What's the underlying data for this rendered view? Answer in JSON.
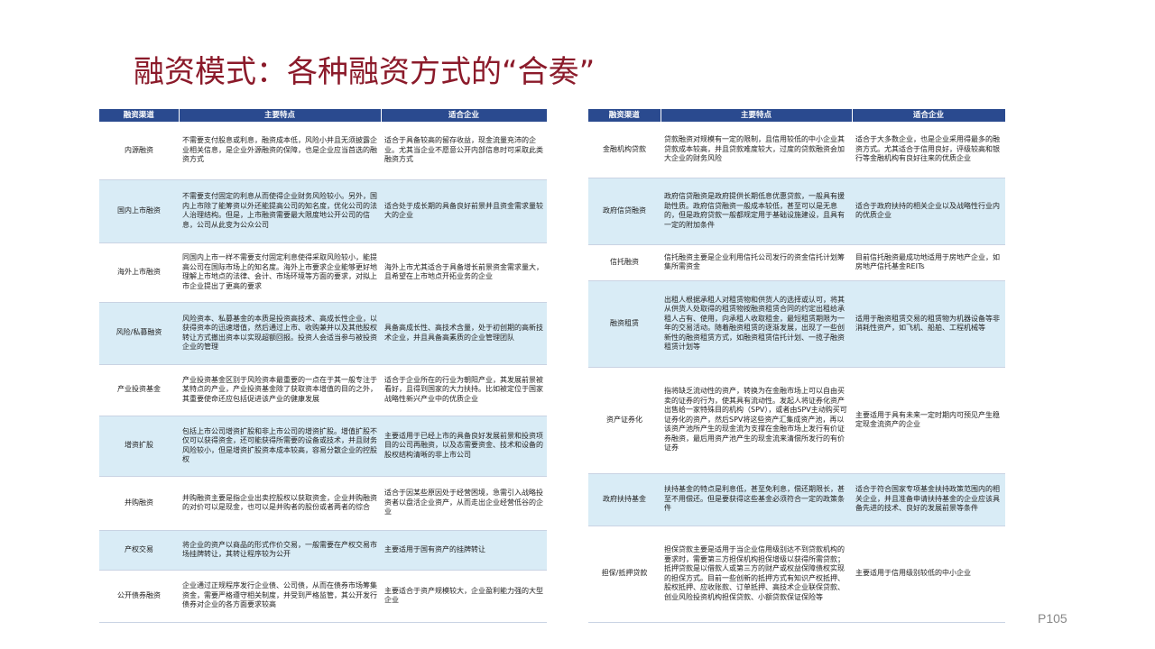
{
  "title": "融资模式：各种融资方式的“合奏”",
  "page_number": "P105",
  "headers": {
    "channel": "融资渠道",
    "features": "主要特点",
    "suitable": "适合企业"
  },
  "left_rows": [
    {
      "channel": "内源融资",
      "features": "不需要支付股息或利息，融资成本低，风险小并且无须披露企业相关信息，是企业外源融资的保障，也是企业应当首选的融资方式",
      "suitable": "适合于具备较高的留存收益，现金流量充沛的企业。尤其当企业不愿意公开内部信息时可采取此类融资方式"
    },
    {
      "channel": "国内上市融资",
      "features": "不需要支付固定的利息从而使得企业财务风险较小。另外，国内上市除了能筹资以外还能提高公司的知名度，优化公司的法人治理结构。但是，上市融资需要最大限度地公开公司的信息，公司从此变为公众公司",
      "suitable": "适合处于成长期的具备良好前景并且资金需求量较大的企业"
    },
    {
      "channel": "海外上市融资",
      "features": "同国内上市一样不需要支付固定利息使得采取风险较小，能提高公司在国际市场上的知名度。海外上市要求企业能够更好地理解上市地点的法律、会计、市场环境等方面的要求，对拟上市企业提出了更高的要求",
      "suitable": "海外上市尤其适合于具备增长前景资金需求量大，且希望在上市地点开拓业务的企业"
    },
    {
      "channel": "风险/私募融资",
      "features": "风险资本、私募基金的本质是投资高技术、高成长性企业，以获得资本的迅速增值，然后通过上市、收购兼并以及其他股权转让方式撤出资本以实现超额回报。投资人会适当参与被投资企业的管理",
      "suitable": "具备高成长性、高技术含量，处于初创期的高新技术企业，并且具备高素质的企业管理团队"
    },
    {
      "channel": "产业投资基金",
      "features": "产业投资基金区别于风险资本最重要的一点在于其一般专注于某特点的产业，产业投资基金除了获取资本增值的目的之外，其重要使命还应包括促进该产业的健康发展",
      "suitable": "适合于企业所在的行业为朝阳产业，其发展前景被看好，且得到国家的大力扶持。比如被定位于国家战略性新兴产业中的优质企业"
    },
    {
      "channel": "增资扩股",
      "features": "包括上市公司增资扩股和非上市公司的增资扩股。增值扩股不仅可以获得资金，还可能获得所需要的设备或技术，并且财务风险较小，但是增资扩股资本成本较高，容易分散企业的控股权",
      "suitable": "主要适用于已经上市的具备良好发展前景和投资项目的公司再融资，以及态需要资金、技术和设备的股权结构清晰的非上市公司"
    },
    {
      "channel": "并购融资",
      "features": "并购融资主要是指企业出卖控股权以获取资金，企业并购融资的对价可以是现金，也可以是并购者的股份或者两者的综合",
      "suitable": "适合于因某些原因处于经营困境，急需引入战略投资者以盘活企业资产，从而走出企业经营低谷的企业"
    },
    {
      "channel": "产权交易",
      "features": "将企业的资产以商品的形式作价交易，一般需要在产权交易市场挂牌转让，其转让程序较为公开",
      "suitable": "主要适用于国有资产的挂牌转让"
    },
    {
      "channel": "公开债券融资",
      "features": "企业通过正规程序发行企业债、公司债，从而在债券市场筹集资金，需要严格遵守相关制度，并受到严格监管，其公开发行债券对企业的各方面要求较高",
      "suitable": "主要适合于资产规模较大，企业盈利能力强的大型企业"
    }
  ],
  "right_rows": [
    {
      "channel": "金融机构贷款",
      "features": "贷款融资对规模有一定的限制，且信用较低的中小企业其贷款成本较高，并且贷款难度较大，过度的贷款融资会加大企业的财务风险",
      "suitable": "适合于大多数企业，也是企业采用得最多的融资方式。尤其适合于信用良好，评级较高和银行等金融机构有良好往来的优质企业"
    },
    {
      "channel": "政府信贷融资",
      "features": "政府信贷融资是政府提供长期低息优惠贷款，一般具有援助性质。政府信贷融资一般成本较低，甚至可以是无息的，但是政府贷款一般都规定用于基础设施建设，且具有一定的附加条件",
      "suitable": "适合于政府扶持的相关企业以及战略性行业内的优质企业"
    },
    {
      "channel": "信托融资",
      "features": "信托融资主要是企业利用信托公司发行的资金信托计划筹集所需资金",
      "suitable": "目前信托融资最成功地适用于房地产企业，如房地产信托基金REITs"
    },
    {
      "channel": "融资租赁",
      "features": "出租人根据承租人对租赁物和供货人的选择或认可，将其从供货人处取得的租赁物按融资租赁合同的约定出租给承租人占有、使用，向承租人收取租金，最短租赁期限为一年的交易活动。随着融资租赁的逐渐发展，出现了一些创新性的融资租赁方式，如融资租赁信托计划、一揽子融资租赁计划等",
      "suitable": "适用于融资租赁交易的租赁物为机器设备等非消耗性资产，如飞机、船舶、工程机械等"
    },
    {
      "channel": "资产证券化",
      "features": "指将缺乏流动性的资产，转换为在金融市场上可以自由买卖的证券的行为，使其具有流动性。发起人将证券化资产出售给一家特殊目的机构（SPV），或者由SPV主动购买可证券化的资产，然后SPV将这些资产汇集成资产池，再以该资产池所产生的现金流为支撑在金融市场上发行有价证券融资，最后用资产池产生的现金流来清偿所发行的有价证券",
      "suitable": "主要适用于具有未来一定时期内可预见产生稳定现金流资产的企业"
    },
    {
      "channel": "政府扶持基金",
      "features": "扶持基金的特点是利息低，甚至免利息，偿还期限长，甚至不用偿还。但是要获得这些基金必须符合一定的政策条件",
      "suitable": "适合于符合国家专项基金扶持政策范围内的相关企业，并且准备申请扶持基金的企业应该具备先进的技术、良好的发展前景等条件"
    },
    {
      "channel": "担保/抵押贷款",
      "features": "担保贷款主要是适用于当企业信用级别达不到贷款机构的要求时，需要第三方担保机构担保增级以获得所需贷款；抵押贷款是以借款人或第三方的财产或权益保障债权实现的担保方式。目前一些创新的抵押方式有知识产权抵押、股权抵押、应收账款、订单抵押、高技术企业联保贷款、创业风险投资机构担保贷款、小额贷款保证保险等",
      "suitable": "主要适用于信用级别较低的中小企业"
    }
  ]
}
